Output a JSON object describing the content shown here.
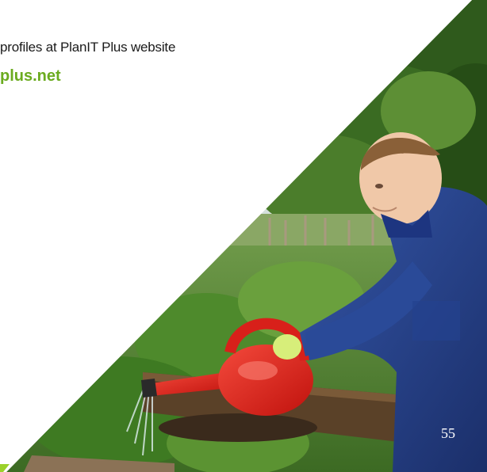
{
  "text": {
    "line1": "profiles at PlanIT Plus website",
    "url": "plus.net"
  },
  "page_number": "55",
  "colors": {
    "url_green": "#6bab1f",
    "text": "#1a1a1a",
    "watering_can": "#e8231e",
    "overalls": "#23408c"
  },
  "photo": {
    "subject-icon": "man-watering-garden-photo"
  }
}
